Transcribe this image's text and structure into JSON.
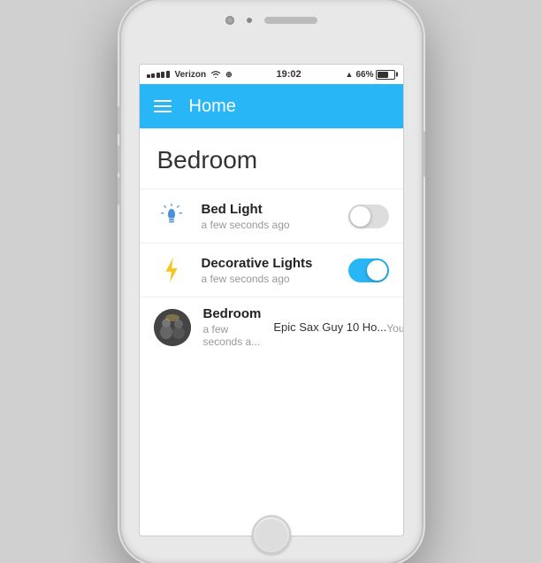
{
  "phone": {
    "status_bar": {
      "carrier": "Verizon",
      "time": "19:02",
      "battery_percent": "66%",
      "location_icon": "▲"
    },
    "app_bar": {
      "title": "Home",
      "menu_icon": "hamburger"
    },
    "content": {
      "section_title": "Bedroom",
      "devices": [
        {
          "id": "bed-light",
          "name": "Bed Light",
          "subtitle": "a few seconds ago",
          "icon_type": "bulb",
          "toggle_state": "off"
        },
        {
          "id": "decorative-lights",
          "name": "Decorative Lights",
          "subtitle": "a few seconds ago",
          "icon_type": "bolt",
          "toggle_state": "on"
        },
        {
          "id": "bedroom-media",
          "name": "Bedroom",
          "subtitle": "a few seconds a...",
          "icon_type": "avatar",
          "media_title": "Epic Sax Guy 10 Ho...",
          "media_source": "YouTube"
        }
      ]
    }
  }
}
